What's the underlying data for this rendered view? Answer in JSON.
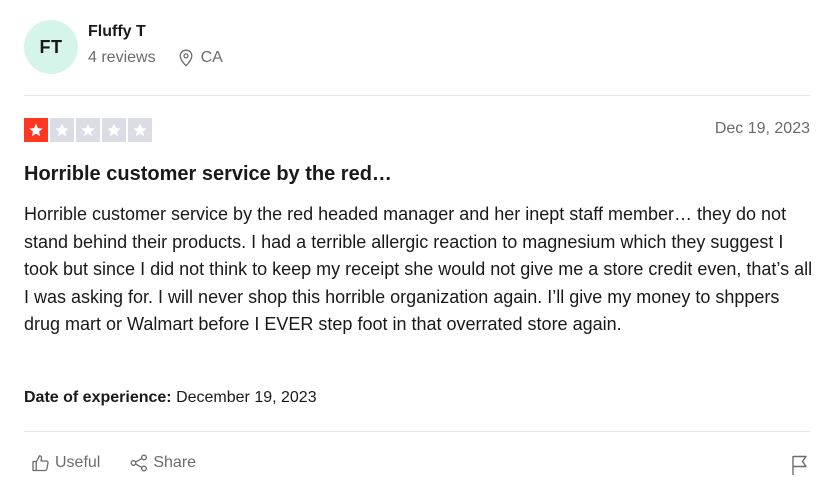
{
  "reviewer": {
    "initials": "FT",
    "name": "Fluffy T",
    "review_count": "4 reviews",
    "location": "CA",
    "avatar_color": "#d6f5ea"
  },
  "review": {
    "rating": 1,
    "max_rating": 5,
    "star_color_active": "#ff3722",
    "star_color_inactive": "#dcdce6",
    "date": "Dec 19, 2023",
    "title": "Horrible customer service by the red…",
    "body": "Horrible customer service by the red headed manager and her inept staff member… they do not stand behind their products. I had a terrible allergic reaction to magnesium which they suggest I took but since I did not think to keep my receipt she would not give me a store credit even, that’s all I was asking for. I will never shop this horrible organization again. I’ll give my money to shppers drug mart or Walmart before I EVER step foot in that overrated store again.",
    "experience_label": "Date of experience:",
    "experience_date": "December 19, 2023"
  },
  "actions": {
    "useful_label": "Useful",
    "share_label": "Share",
    "useful_icon": "thumbs-up-icon",
    "share_icon": "share-icon",
    "flag_icon": "flag-icon",
    "location_icon": "location-pin-icon"
  }
}
